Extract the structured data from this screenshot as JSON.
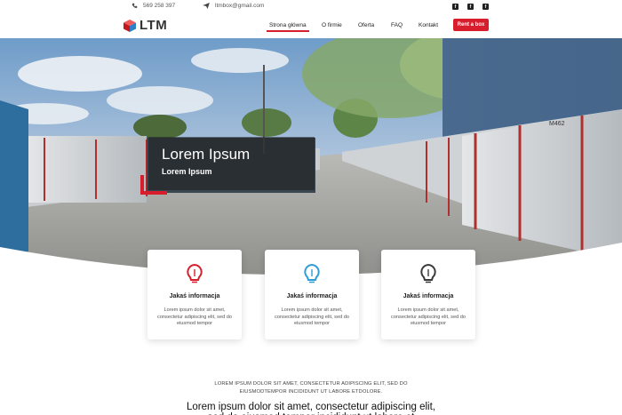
{
  "topbar": {
    "phone": "569 258 397",
    "email": "ltmbox@gmail.com",
    "social": [
      {
        "icon": "facebook-icon",
        "glyph": "f"
      },
      {
        "icon": "facebook-icon",
        "glyph": "f"
      },
      {
        "icon": "facebook-icon",
        "glyph": "f"
      }
    ]
  },
  "nav": {
    "logo_text": "LTM",
    "items": [
      "Strona główna",
      "O firmie",
      "Oferta",
      "FAQ",
      "Kontakt"
    ],
    "active_index": 0,
    "cta_label": "Rent a box"
  },
  "hero": {
    "title": "Lorem Ipsum",
    "subtitle": "Lorem Ipsum",
    "container_label": "M462"
  },
  "cards": [
    {
      "icon": "lightbulb-icon",
      "icon_color": "#d81e2c",
      "title": "Jakaś informacja",
      "text": "Lorem ipsum dolor sit amet, consectetur adipiscing elit, sed do eiusmod tempor"
    },
    {
      "icon": "lightbulb-icon",
      "icon_color": "#2f9bd8",
      "title": "Jakaś informacja",
      "text": "Lorem ipsum dolor sit amet, consectetur adipiscing elit, sed do eiusmod tempor"
    },
    {
      "icon": "lightbulb-icon",
      "icon_color": "#3a3a3a",
      "title": "Jakaś informacja",
      "text": "Lorem ipsum dolor sit amet, consectetur adipiscing elit, sed do eiusmod tempor"
    }
  ],
  "section": {
    "caps_text": "LOREM IPSUM DOLOR SIT AMET, CONSECTETUR ADIPISCING ELIT, SED DO EIUSMODTEMPOR INCIDIDUNT UT LABORE ETDOLORE.",
    "heading": "Lorem ipsum dolor sit amet, consectetur adipiscing elit, sed do eiusmod tempor incididunt ut labore et"
  },
  "colors": {
    "accent": "#d81e2c",
    "blue": "#2f9bd8",
    "dark": "#3a3a3a"
  }
}
